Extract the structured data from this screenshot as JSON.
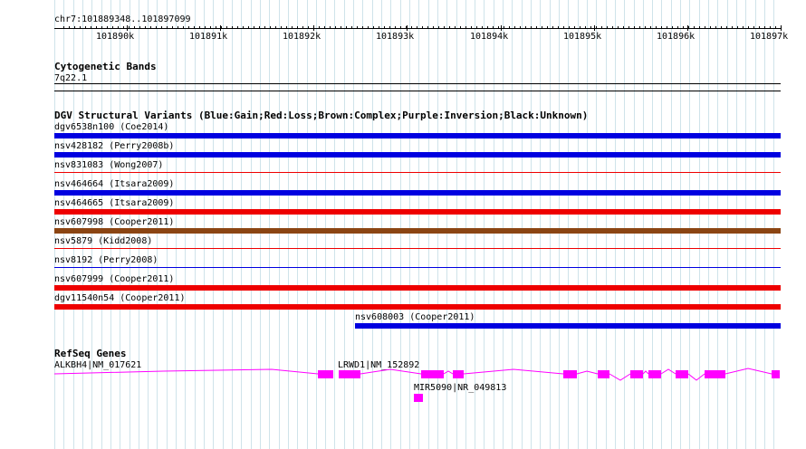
{
  "ruler": {
    "location": "chr7:101889348..101897099",
    "ticks": [
      "101890k",
      "101891k",
      "101892k",
      "101893k",
      "101894k",
      "101895k",
      "101896k",
      "101897k"
    ]
  },
  "cytoband": {
    "title": "Cytogenetic Bands",
    "band": "7q22.1"
  },
  "dgv": {
    "title": "DGV Structural Variants (Blue:Gain;Red:Loss;Brown:Complex;Purple:Inversion;Black:Unknown)",
    "colors": {
      "gain": "#0000e0",
      "loss": "#ee0000",
      "complex": "#8b4513"
    },
    "variants": [
      {
        "label": "dgv6538n100 (Coe2014)",
        "type": "gain",
        "style": "thick"
      },
      {
        "label": "nsv428182 (Perry2008b)",
        "type": "gain",
        "style": "thick"
      },
      {
        "label": "nsv831083 (Wong2007)",
        "type": "loss",
        "style": "thin"
      },
      {
        "label": "nsv464664 (Itsara2009)",
        "type": "gain",
        "style": "thick"
      },
      {
        "label": "nsv464665 (Itsara2009)",
        "type": "loss",
        "style": "thick"
      },
      {
        "label": "nsv607998 (Cooper2011)",
        "type": "complex",
        "style": "thick"
      },
      {
        "label": "nsv5879 (Kidd2008)",
        "type": "loss",
        "style": "thin"
      },
      {
        "label": "nsv8192 (Perry2008)",
        "type": "gain",
        "style": "thin"
      },
      {
        "label": "nsv607999 (Cooper2011)",
        "type": "loss",
        "style": "thick"
      },
      {
        "label": "dgv11540n54 (Cooper2011)",
        "type": "loss",
        "style": "thick"
      },
      {
        "label": "nsv608003 (Cooper2011)",
        "type": "gain",
        "style": "thick"
      }
    ]
  },
  "refseq": {
    "title": "RefSeq Genes",
    "genes": [
      {
        "label": "ALKBH4|NM_017621"
      },
      {
        "label": "LRWD1|NM_152892"
      },
      {
        "label": "MIR5090|NR_049813"
      }
    ],
    "color": "#ff00ff"
  }
}
